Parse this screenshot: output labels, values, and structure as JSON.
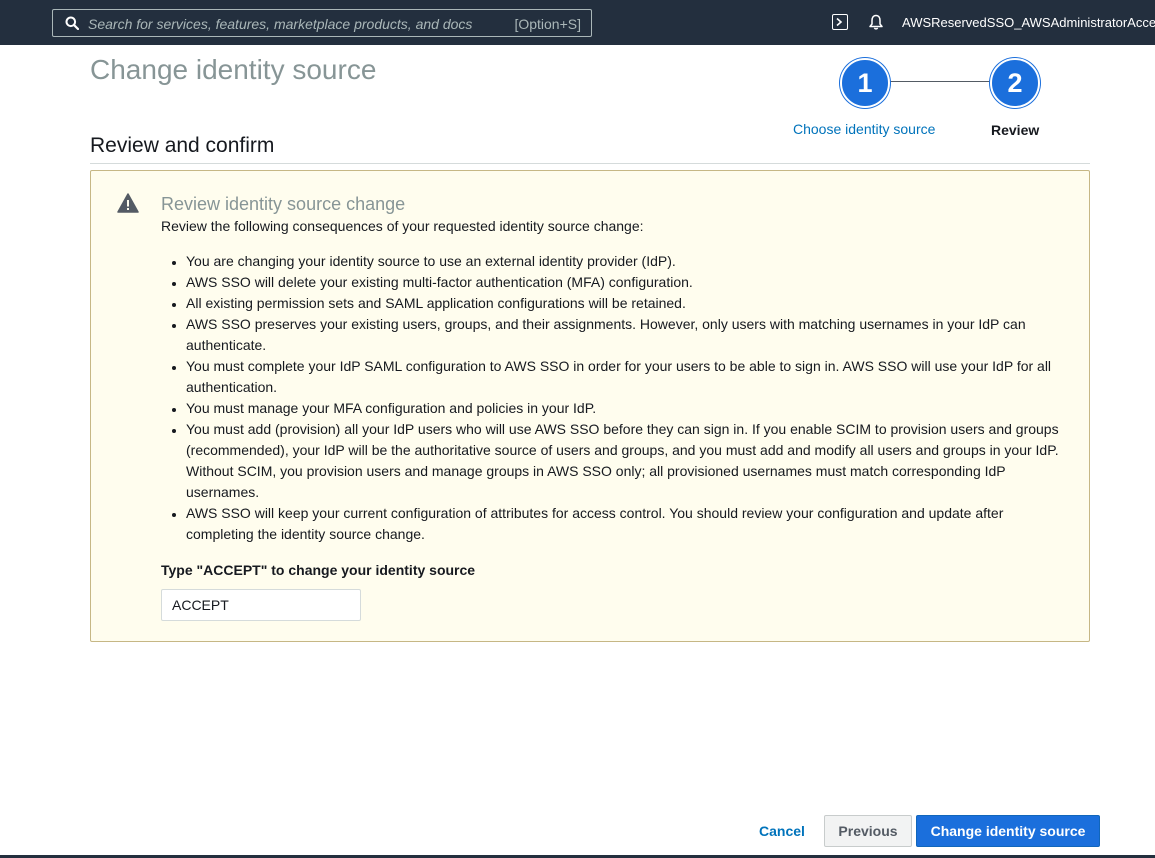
{
  "topbar": {
    "search_placeholder": "Search for services, features, marketplace products, and docs",
    "search_shortcut": "[Option+S]",
    "account_name": "AWSReservedSSO_AWSAdministratorAccess_",
    "icons": [
      "search-icon",
      "cloudshell-icon",
      "bell-icon"
    ]
  },
  "page": {
    "title": "Change identity source"
  },
  "wizard": {
    "steps": [
      {
        "number": "1",
        "label": "Choose identity source",
        "state": "link"
      },
      {
        "number": "2",
        "label": "Review",
        "state": "current"
      }
    ]
  },
  "section": {
    "heading": "Review and confirm"
  },
  "warning": {
    "icon": "warning-icon",
    "title": "Review identity source change",
    "intro": "Review the following consequences of your requested identity source change:",
    "items": [
      "You are changing your identity source to use an external identity provider (IdP).",
      "AWS SSO will delete your existing multi-factor authentication (MFA) configuration.",
      "All existing permission sets and SAML application configurations will be retained.",
      "AWS SSO preserves your existing users, groups, and their assignments. However, only users with matching usernames in your IdP can authenticate.",
      "You must complete your IdP SAML configuration to AWS SSO in order for your users to be able to sign in. AWS SSO will use your IdP for all authentication.",
      "You must manage your MFA configuration and policies in your IdP.",
      "You must add (provision) all your IdP users who will use AWS SSO before they can sign in. If you enable SCIM to provision users and groups (recommended), your IdP will be the authoritative source of users and groups, and you must add and modify all users and groups in your IdP. Without SCIM, you provision users and manage groups in AWS SSO only; all provisioned usernames must match corresponding IdP usernames.",
      "AWS SSO will keep your current configuration of attributes for access control. You should review your configuration and update after completing the identity source change."
    ],
    "accept_label": "Type \"ACCEPT\" to change your identity source",
    "accept_value": "ACCEPT"
  },
  "footer": {
    "cancel_label": "Cancel",
    "previous_label": "Previous",
    "submit_label": "Change identity source"
  },
  "colors": {
    "nav_bg": "#232f3e",
    "primary": "#1b6fdc",
    "link": "#0073bb",
    "warning_bg": "#fffdee",
    "warning_border": "#c6b785"
  }
}
